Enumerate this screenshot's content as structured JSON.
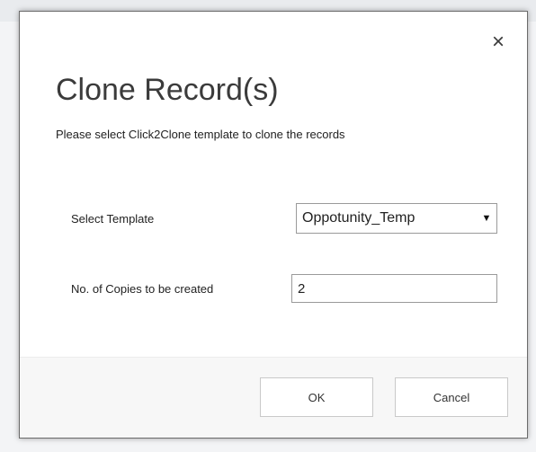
{
  "dialog": {
    "close_symbol": "×",
    "title": "Clone Record(s)",
    "subtitle": "Please select Click2Clone template to clone the records"
  },
  "form": {
    "template_label": "Select Template",
    "template_selected": "Oppotunity_Temp",
    "template_arrow": "▼",
    "copies_label": "No. of Copies to be created",
    "copies_value": "2"
  },
  "footer": {
    "ok_label": "OK",
    "cancel_label": "Cancel"
  }
}
